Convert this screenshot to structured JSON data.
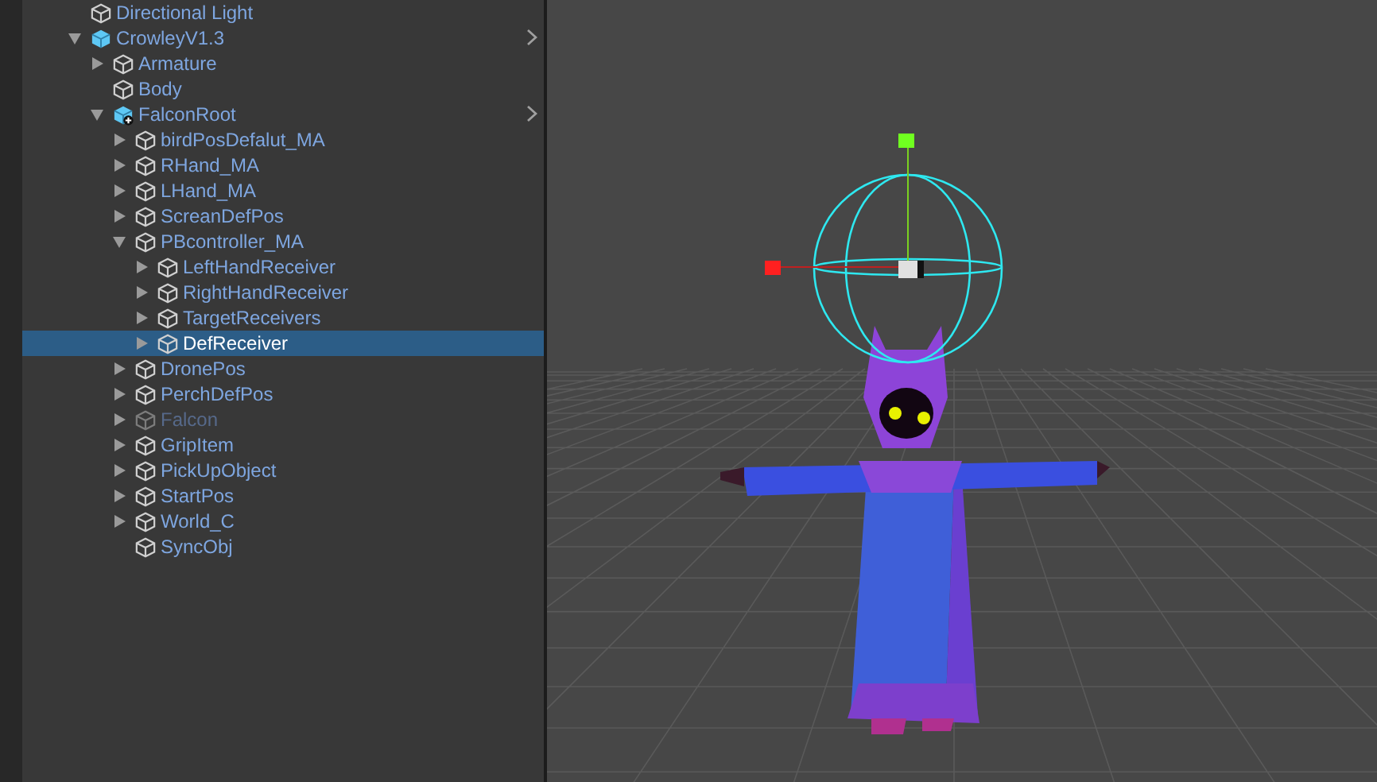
{
  "hierarchy": {
    "items": [
      {
        "label": "Directional Light",
        "kind": "object",
        "active": true,
        "selected": false
      },
      {
        "label": "CrowleyV1.3",
        "kind": "prefab",
        "active": true,
        "selected": false,
        "expanded": true,
        "children": [
          {
            "label": "Armature",
            "kind": "object",
            "active": true,
            "selected": false,
            "expanded": false
          },
          {
            "label": "Body",
            "kind": "object",
            "active": true,
            "selected": false
          },
          {
            "label": "FalconRoot",
            "kind": "prefab-added",
            "active": true,
            "selected": false,
            "expanded": true,
            "children": [
              {
                "label": "birdPosDefalut_MA",
                "kind": "object",
                "active": true,
                "selected": false,
                "expanded": false
              },
              {
                "label": "RHand_MA",
                "kind": "object",
                "active": true,
                "selected": false,
                "expanded": false
              },
              {
                "label": "LHand_MA",
                "kind": "object",
                "active": true,
                "selected": false,
                "expanded": false
              },
              {
                "label": "ScreanDefPos",
                "kind": "object",
                "active": true,
                "selected": false,
                "expanded": false
              },
              {
                "label": "PBcontroller_MA",
                "kind": "object",
                "active": true,
                "selected": false,
                "expanded": true,
                "children": [
                  {
                    "label": "LeftHandReceiver",
                    "kind": "object",
                    "active": true,
                    "selected": false,
                    "expanded": false
                  },
                  {
                    "label": "RightHandReceiver",
                    "kind": "object",
                    "active": true,
                    "selected": false,
                    "expanded": false
                  },
                  {
                    "label": "TargetReceivers",
                    "kind": "object",
                    "active": true,
                    "selected": false,
                    "expanded": false
                  },
                  {
                    "label": "DefReceiver",
                    "kind": "object",
                    "active": true,
                    "selected": true,
                    "expanded": false
                  }
                ]
              },
              {
                "label": "DronePos",
                "kind": "object",
                "active": true,
                "selected": false,
                "expanded": false
              },
              {
                "label": "PerchDefPos",
                "kind": "object",
                "active": true,
                "selected": false,
                "expanded": false
              },
              {
                "label": "Falcon",
                "kind": "object",
                "active": false,
                "selected": false,
                "expanded": false
              },
              {
                "label": "GripItem",
                "kind": "object",
                "active": true,
                "selected": false,
                "expanded": false
              },
              {
                "label": "PickUpObject",
                "kind": "object",
                "active": true,
                "selected": false,
                "expanded": false
              },
              {
                "label": "StartPos",
                "kind": "object",
                "active": true,
                "selected": false,
                "expanded": false
              },
              {
                "label": "World_C",
                "kind": "object",
                "active": true,
                "selected": false,
                "expanded": false
              },
              {
                "label": "SyncObj",
                "kind": "object",
                "active": true,
                "selected": false
              }
            ]
          }
        ]
      }
    ]
  }
}
